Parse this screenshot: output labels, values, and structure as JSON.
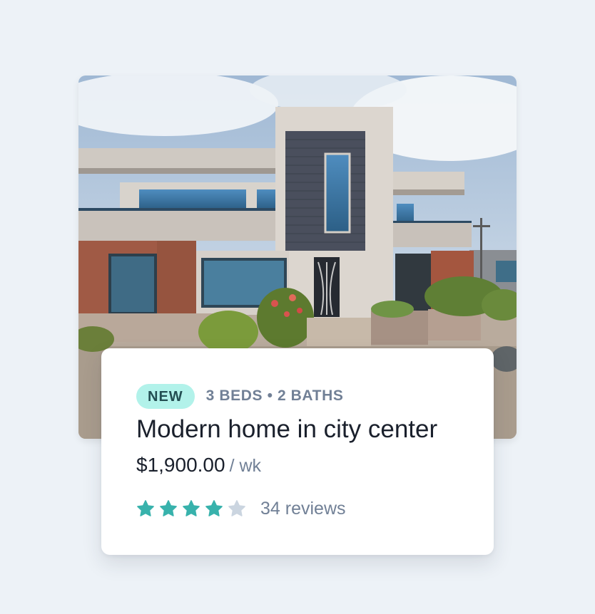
{
  "listing": {
    "badge": "NEW",
    "meta": "3 BEDS • 2 BATHS",
    "title": "Modern home in city center",
    "price": "$1,900.00",
    "price_unit": "/ wk",
    "rating": 4,
    "rating_max": 5,
    "reviews": "34 reviews"
  },
  "colors": {
    "background": "#edf2f7",
    "badge_bg": "#b2f2ea",
    "badge_text": "#234e52",
    "star_filled": "#38b2ac",
    "star_empty": "#cbd5e0",
    "muted_text": "#718096"
  },
  "icons": {
    "star": "star-icon",
    "photo": "house-photo"
  }
}
